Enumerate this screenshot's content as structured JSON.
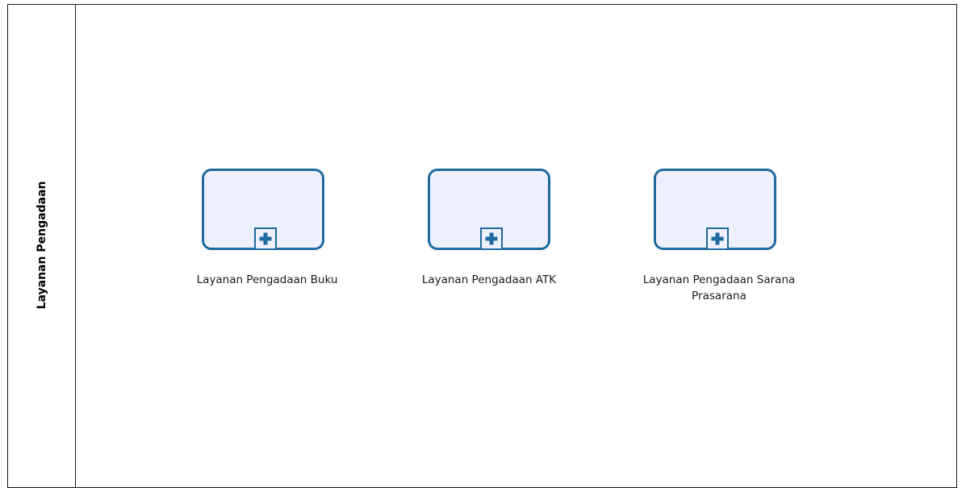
{
  "pool": {
    "label": "Layanan Pengadaan"
  },
  "tasks": [
    {
      "label": "Layanan Pengadaan Buku",
      "marker": "plus-icon"
    },
    {
      "label": "Layanan Pengadaan ATK",
      "marker": "plus-icon"
    },
    {
      "label": "Layanan Pengadaan Sarana Prasarana",
      "marker": "plus-icon"
    }
  ],
  "colors": {
    "task_border": "#1f6a9e",
    "task_fill": "#eef1fd",
    "pool_border": "#1a1a1a"
  }
}
